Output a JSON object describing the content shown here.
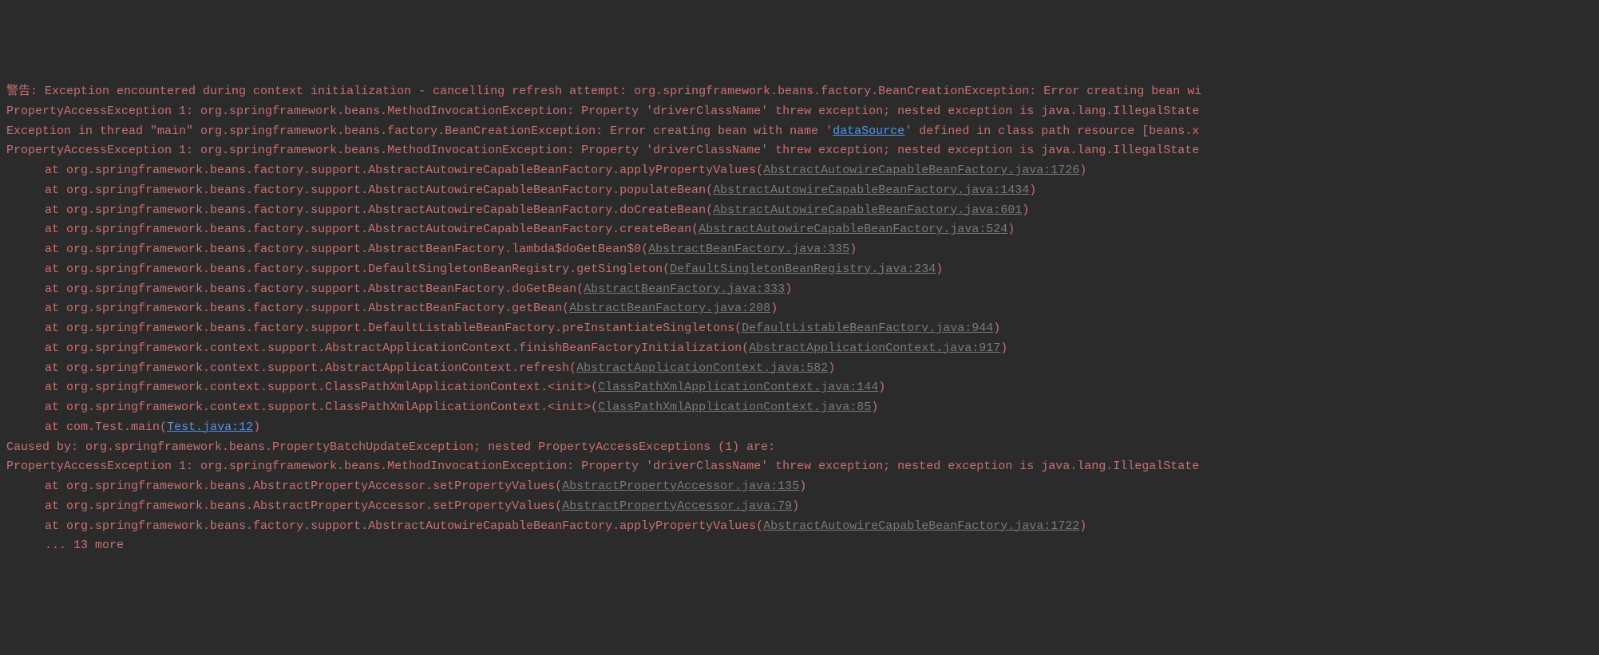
{
  "lines": [
    {
      "type": "plain",
      "text": "警告: Exception encountered during context initialization - cancelling refresh attempt: org.springframework.beans.factory.BeanCreationException: Error creating bean wi"
    },
    {
      "type": "plain",
      "text": "PropertyAccessException 1: org.springframework.beans.MethodInvocationException: Property 'driverClassName' threw exception; nested exception is java.lang.IllegalState"
    },
    {
      "type": "inline-link",
      "pre": "Exception in thread \"main\" org.springframework.beans.factory.BeanCreationException: Error creating bean with name '",
      "linkText": "dataSource",
      "linkClass": "link-strong",
      "post": "' defined in class path resource [beans.x"
    },
    {
      "type": "plain",
      "text": "PropertyAccessException 1: org.springframework.beans.MethodInvocationException: Property 'driverClassName' threw exception; nested exception is java.lang.IllegalState"
    },
    {
      "type": "stack",
      "at": "at ",
      "method": "org.springframework.beans.factory.support.AbstractAutowireCapableBeanFactory.applyPropertyValues",
      "linkText": "AbstractAutowireCapableBeanFactory.java:1726",
      "linkClass": "link"
    },
    {
      "type": "stack",
      "at": "at ",
      "method": "org.springframework.beans.factory.support.AbstractAutowireCapableBeanFactory.populateBean",
      "linkText": "AbstractAutowireCapableBeanFactory.java:1434",
      "linkClass": "link"
    },
    {
      "type": "stack",
      "at": "at ",
      "method": "org.springframework.beans.factory.support.AbstractAutowireCapableBeanFactory.doCreateBean",
      "linkText": "AbstractAutowireCapableBeanFactory.java:601",
      "linkClass": "link"
    },
    {
      "type": "stack",
      "at": "at ",
      "method": "org.springframework.beans.factory.support.AbstractAutowireCapableBeanFactory.createBean",
      "linkText": "AbstractAutowireCapableBeanFactory.java:524",
      "linkClass": "link"
    },
    {
      "type": "stack",
      "at": "at ",
      "method": "org.springframework.beans.factory.support.AbstractBeanFactory.lambda$doGetBean$0",
      "linkText": "AbstractBeanFactory.java:335",
      "linkClass": "link"
    },
    {
      "type": "stack",
      "at": "at ",
      "method": "org.springframework.beans.factory.support.DefaultSingletonBeanRegistry.getSingleton",
      "linkText": "DefaultSingletonBeanRegistry.java:234",
      "linkClass": "link"
    },
    {
      "type": "stack",
      "at": "at ",
      "method": "org.springframework.beans.factory.support.AbstractBeanFactory.doGetBean",
      "linkText": "AbstractBeanFactory.java:333",
      "linkClass": "link"
    },
    {
      "type": "stack",
      "at": "at ",
      "method": "org.springframework.beans.factory.support.AbstractBeanFactory.getBean",
      "linkText": "AbstractBeanFactory.java:208",
      "linkClass": "link"
    },
    {
      "type": "stack",
      "at": "at ",
      "method": "org.springframework.beans.factory.support.DefaultListableBeanFactory.preInstantiateSingletons",
      "linkText": "DefaultListableBeanFactory.java:944",
      "linkClass": "link"
    },
    {
      "type": "stack",
      "at": "at ",
      "method": "org.springframework.context.support.AbstractApplicationContext.finishBeanFactoryInitialization",
      "linkText": "AbstractApplicationContext.java:917",
      "linkClass": "link"
    },
    {
      "type": "stack",
      "at": "at ",
      "method": "org.springframework.context.support.AbstractApplicationContext.refresh",
      "linkText": "AbstractApplicationContext.java:582",
      "linkClass": "link"
    },
    {
      "type": "stack",
      "at": "at ",
      "method": "org.springframework.context.support.ClassPathXmlApplicationContext.<init>",
      "linkText": "ClassPathXmlApplicationContext.java:144",
      "linkClass": "link"
    },
    {
      "type": "stack",
      "at": "at ",
      "method": "org.springframework.context.support.ClassPathXmlApplicationContext.<init>",
      "linkText": "ClassPathXmlApplicationContext.java:85",
      "linkClass": "link"
    },
    {
      "type": "stack",
      "at": "at ",
      "method": "com.Test.main",
      "linkText": "Test.java:12",
      "linkClass": "link-strong"
    },
    {
      "type": "plain",
      "text": "Caused by: org.springframework.beans.PropertyBatchUpdateException; nested PropertyAccessExceptions (1) are:"
    },
    {
      "type": "plain",
      "text": "PropertyAccessException 1: org.springframework.beans.MethodInvocationException: Property 'driverClassName' threw exception; nested exception is java.lang.IllegalState"
    },
    {
      "type": "stack",
      "at": "at ",
      "method": "org.springframework.beans.AbstractPropertyAccessor.setPropertyValues",
      "linkText": "AbstractPropertyAccessor.java:135",
      "linkClass": "link"
    },
    {
      "type": "stack",
      "at": "at ",
      "method": "org.springframework.beans.AbstractPropertyAccessor.setPropertyValues",
      "linkText": "AbstractPropertyAccessor.java:79",
      "linkClass": "link"
    },
    {
      "type": "stack",
      "at": "at ",
      "method": "org.springframework.beans.factory.support.AbstractAutowireCapableBeanFactory.applyPropertyValues",
      "linkText": "AbstractAutowireCapableBeanFactory.java:1722",
      "linkClass": "link"
    },
    {
      "type": "plain-indent",
      "text": "... 13 more"
    }
  ]
}
